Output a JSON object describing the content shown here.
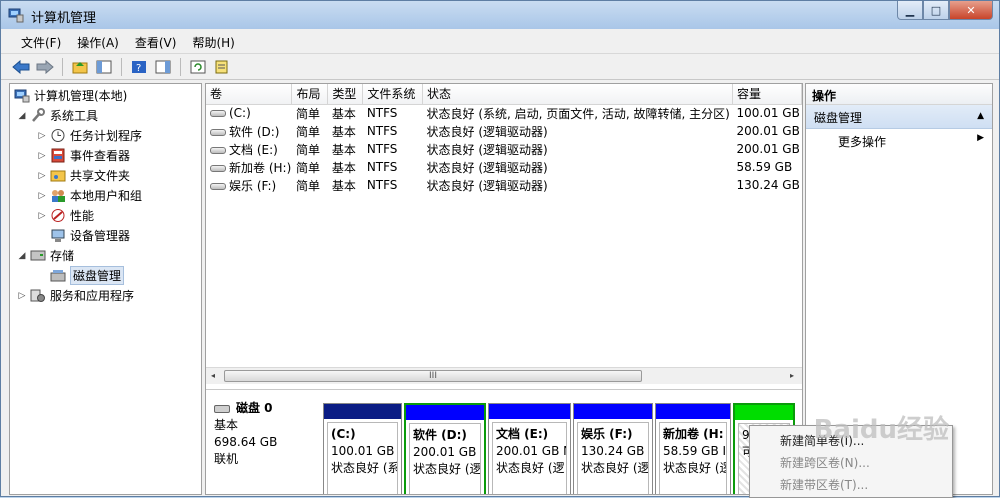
{
  "window": {
    "title": "计算机管理",
    "min": "▁",
    "max": "□",
    "close": "✕"
  },
  "menu": [
    "文件(F)",
    "操作(A)",
    "查看(V)",
    "帮助(H)"
  ],
  "tree": {
    "root": "计算机管理(本地)",
    "system_tools": "系统工具",
    "task_scheduler": "任务计划程序",
    "event_viewer": "事件查看器",
    "shared_folders": "共享文件夹",
    "local_users": "本地用户和组",
    "performance": "性能",
    "device_manager": "设备管理器",
    "storage": "存储",
    "disk_management": "磁盘管理",
    "services_apps": "服务和应用程序"
  },
  "table": {
    "headers": [
      "卷",
      "布局",
      "类型",
      "文件系统",
      "状态",
      "容量"
    ],
    "rows": [
      [
        "(C:)",
        "简单",
        "基本",
        "NTFS",
        "状态良好 (系统, 启动, 页面文件, 活动, 故障转储, 主分区)",
        "100.01 GB"
      ],
      [
        "软件 (D:)",
        "简单",
        "基本",
        "NTFS",
        "状态良好 (逻辑驱动器)",
        "200.01 GB"
      ],
      [
        "文档 (E:)",
        "简单",
        "基本",
        "NTFS",
        "状态良好 (逻辑驱动器)",
        "200.01 GB"
      ],
      [
        "新加卷 (H:)",
        "简单",
        "基本",
        "NTFS",
        "状态良好 (逻辑驱动器)",
        "58.59 GB"
      ],
      [
        "娱乐 (F:)",
        "简单",
        "基本",
        "NTFS",
        "状态良好 (逻辑驱动器)",
        "130.24 GB"
      ]
    ]
  },
  "scroll": {
    "thumb_grip": "III",
    "left": "◂",
    "right": "▸"
  },
  "disk": {
    "name": "磁盘 0",
    "type": "基本",
    "size": "698.64 GB",
    "status": "联机"
  },
  "partitions": [
    {
      "name": "(C:)",
      "size": "100.01 GB",
      "status": "状态良好 (系",
      "color": "#0a1c84"
    },
    {
      "name": "软件 (D:)",
      "size": "200.01 GB I",
      "status": "状态良好 (逻",
      "color": "#0000ff"
    },
    {
      "name": "文档 (E:)",
      "size": "200.01 GB N",
      "status": "状态良好 (逻",
      "color": "#0000ff"
    },
    {
      "name": "娱乐 (F:)",
      "size": "130.24 GB I",
      "status": "状态良好 (逻",
      "color": "#0000ff"
    },
    {
      "name": "新加卷 (H:",
      "size": "58.59 GB I",
      "status": "状态良好 (逻",
      "color": "#0000ff"
    },
    {
      "name": "",
      "size": "9.",
      "status": "可",
      "color": "#00dd00"
    }
  ],
  "actions": {
    "header": "操作",
    "section": "磁盘管理",
    "more": "更多操作"
  },
  "context_menu": [
    "新建简单卷(I)...",
    "新建跨区卷(N)...",
    "新建带区卷(T)..."
  ],
  "watermark": "Baidu经验"
}
